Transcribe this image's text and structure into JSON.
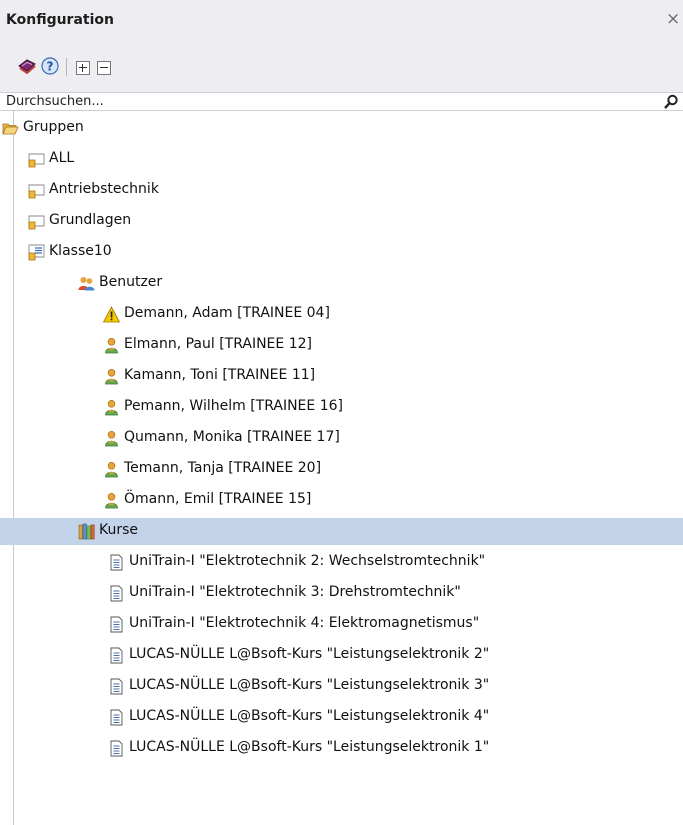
{
  "panel": {
    "title": "Konfiguration",
    "close_icon": "close-icon"
  },
  "toolbar": {
    "buttons": [
      {
        "name": "book-icon"
      },
      {
        "name": "help-icon"
      },
      {
        "name": "expand-all-icon"
      },
      {
        "name": "collapse-all-icon"
      }
    ]
  },
  "search": {
    "placeholder": "Durchsuchen...",
    "value": ""
  },
  "tree": {
    "root": {
      "label": "Gruppen",
      "icon": "folder-open-icon"
    },
    "groups": [
      {
        "label": "ALL",
        "icon": "group-icon"
      },
      {
        "label": "Antriebstechnik",
        "icon": "group-icon"
      },
      {
        "label": "Grundlagen",
        "icon": "group-icon"
      },
      {
        "label": "Klasse10",
        "icon": "group-expanded-icon"
      }
    ],
    "users_node": {
      "label": "Benutzer",
      "icon": "users-icon"
    },
    "users": [
      {
        "label": "Demann, Adam [TRAINEE 04]",
        "icon": "warning-icon"
      },
      {
        "label": "Elmann, Paul [TRAINEE 12]",
        "icon": "user-icon"
      },
      {
        "label": "Kamann, Toni [TRAINEE 11]",
        "icon": "user-icon"
      },
      {
        "label": "Pemann, Wilhelm [TRAINEE 16]",
        "icon": "user-icon"
      },
      {
        "label": "Qumann, Monika [TRAINEE 17]",
        "icon": "user-icon"
      },
      {
        "label": "Temann, Tanja [TRAINEE 20]",
        "icon": "user-icon"
      },
      {
        "label": "Ömann, Emil [TRAINEE 15]",
        "icon": "user-icon"
      }
    ],
    "courses_node": {
      "label": "Kurse",
      "icon": "books-icon",
      "selected": true
    },
    "courses": [
      {
        "label": "UniTrain-I \"Elektrotechnik 2: Wechselstromtechnik\"",
        "icon": "document-icon"
      },
      {
        "label": "UniTrain-I \"Elektrotechnik 3: Drehstromtechnik\"",
        "icon": "document-icon"
      },
      {
        "label": "UniTrain-I \"Elektrotechnik 4: Elektromagnetismus\"",
        "icon": "document-icon"
      },
      {
        "label": "LUCAS-NÜLLE L@Bsoft-Kurs \"Leistungselektronik 2\"",
        "icon": "document-icon"
      },
      {
        "label": "LUCAS-NÜLLE L@Bsoft-Kurs \"Leistungselektronik 3\"",
        "icon": "document-icon"
      },
      {
        "label": "LUCAS-NÜLLE L@Bsoft-Kurs \"Leistungselektronik 4\"",
        "icon": "document-icon"
      },
      {
        "label": "LUCAS-NÜLLE L@Bsoft-Kurs \"Leistungselektronik 1\"",
        "icon": "document-icon"
      }
    ]
  },
  "colors": {
    "header_bg": "#eeeef2",
    "selection": "#c3d3ea",
    "folder": "#e8b84a",
    "user_icon": "#e0a030",
    "warning": "#f2c200"
  }
}
